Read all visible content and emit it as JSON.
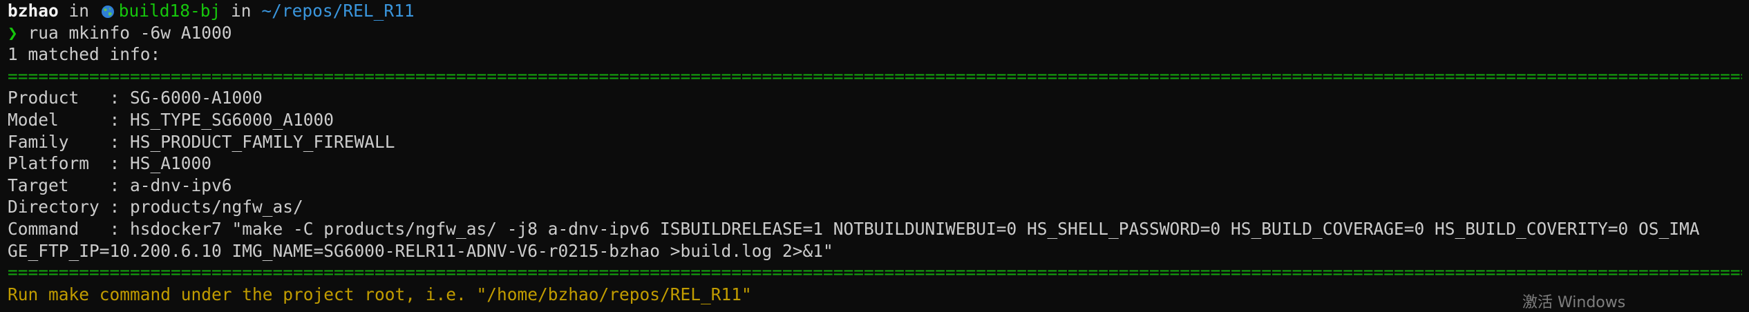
{
  "prompt": {
    "user": "bzhao",
    "in1": " in ",
    "host": "build18-bj",
    "in2": " in ",
    "path": "~/repos/REL_R11"
  },
  "command": {
    "symbol": "❯",
    "text": " rua mkinfo -6w A1000"
  },
  "output": {
    "match_line": "1 matched info:",
    "separator": "==================================================================================================================================================================================================================================================================",
    "fields": [
      {
        "key": "Product   : ",
        "value": "SG-6000-A1000"
      },
      {
        "key": "Model     : ",
        "value": "HS_TYPE_SG6000_A1000"
      },
      {
        "key": "Family    : ",
        "value": "HS_PRODUCT_FAMILY_FIREWALL"
      },
      {
        "key": "Platform  : ",
        "value": "HS_A1000"
      },
      {
        "key": "Target    : ",
        "value": "a-dnv-ipv6"
      },
      {
        "key": "Directory : ",
        "value": "products/ngfw_as/"
      },
      {
        "key": "Command   : ",
        "value": "hsdocker7 \"make -C products/ngfw_as/ -j8 a-dnv-ipv6 ISBUILDRELEASE=1 NOTBUILDUNIWEBUI=0 HS_SHELL_PASSWORD=0 HS_BUILD_COVERAGE=0 HS_BUILD_COVERITY=0 OS_IMA"
      }
    ],
    "command_continuation": "GE_FTP_IP=10.200.6.10 IMG_NAME=SG6000-RELR11-ADNV-V6-r0215-bzhao >build.log 2>&1\"",
    "hint": "Run make command under the project root, i.e. \"/home/bzhao/repos/REL_R11\""
  },
  "watermark": "激活 Windows",
  "colors": {
    "background": "#0c0c0c",
    "foreground": "#cccccc",
    "host_green": "#16c60c",
    "path_blue": "#3a96dd",
    "rule_green": "#13a10e",
    "hint_yellow": "#c19c00"
  },
  "icons": {
    "host": "globe-icon"
  }
}
